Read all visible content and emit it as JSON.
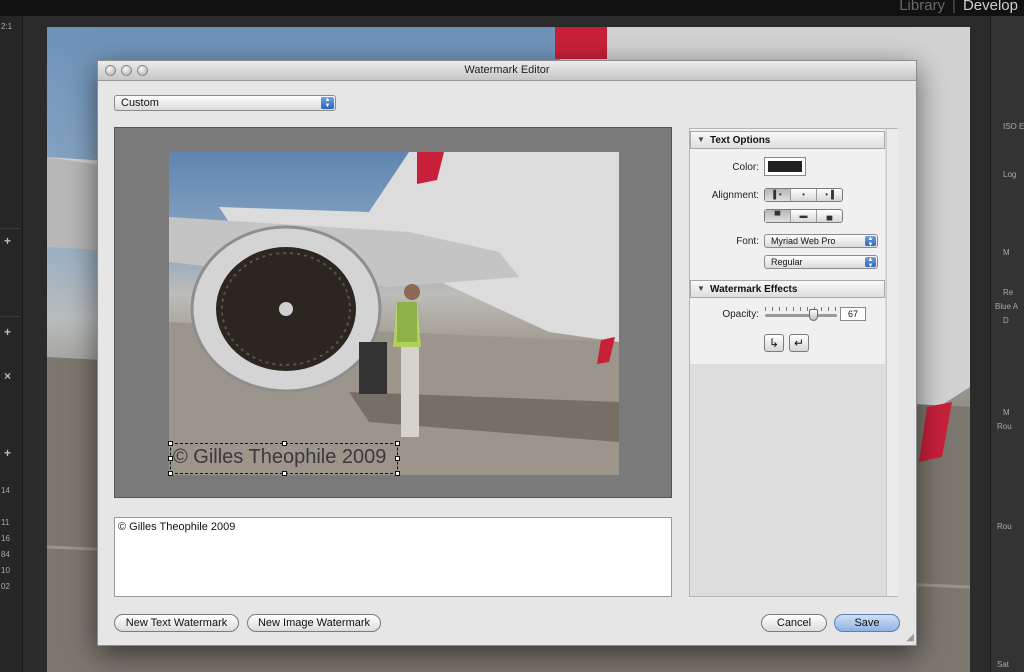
{
  "app": {
    "module_picker": {
      "library": "Library",
      "develop": "Develop"
    },
    "left_panel": {
      "values": [
        "2:1",
        "14",
        "11",
        "16",
        "84",
        "10",
        "02"
      ]
    },
    "right_panel": {
      "labels": [
        "ISO E",
        "Log",
        "M",
        "Re",
        "Blue A",
        "D",
        "M",
        "Rou",
        "Rou",
        "Sat"
      ]
    }
  },
  "dialog": {
    "title": "Watermark Editor",
    "preset": {
      "value": "Custom"
    },
    "preview": {
      "watermark_text": "© Gilles Theophile 2009"
    },
    "text_field": {
      "value": "© Gilles Theophile 2009"
    },
    "buttons": {
      "new_text": "New Text Watermark",
      "new_image": "New Image Watermark",
      "cancel": "Cancel",
      "save": "Save"
    },
    "text_options": {
      "header": "Text Options",
      "color_label": "Color:",
      "color_value": "#222222",
      "alignment_label": "Alignment:",
      "font_label": "Font:",
      "font_value": "Myriad Web Pro",
      "style_value": "Regular"
    },
    "watermark_effects": {
      "header": "Watermark Effects",
      "opacity_label": "Opacity:",
      "opacity_value": "67",
      "opacity_fraction": 0.67
    }
  }
}
